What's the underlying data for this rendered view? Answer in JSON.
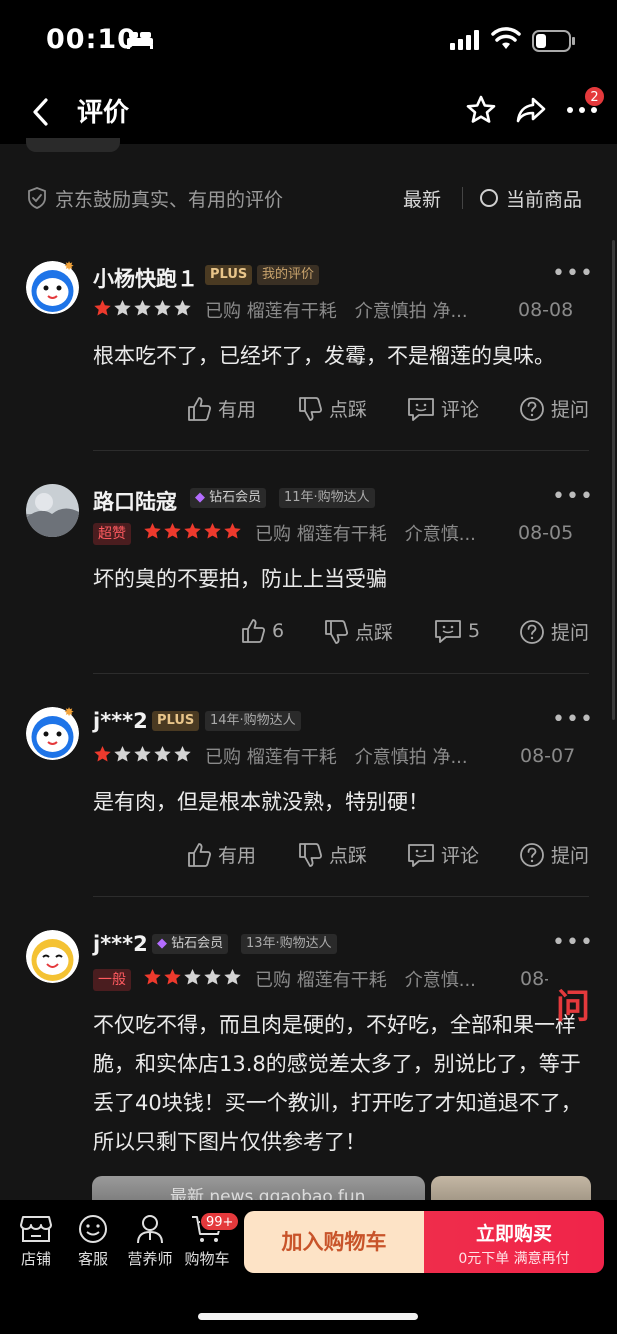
{
  "status_bar": {
    "time": "00:10"
  },
  "nav": {
    "title": "评价",
    "more_badge": "2"
  },
  "filter": {
    "encourage_text": "京东鼓励真实、有用的评价",
    "sort_latest": "最新",
    "current_product": "当前商品"
  },
  "reviews": [
    {
      "name": "小杨快跑１",
      "tags": [
        "PLUS",
        "我的评价"
      ],
      "rating": 1,
      "badge": "",
      "purchase": "已购 榴莲有干耗　介意慎拍 净...",
      "date": "08-08",
      "content": "根本吃不了，已经坏了，发霉，不是榴莲的臭味。",
      "useful": "有用",
      "dislike": "点踩",
      "comment": "评论",
      "ask": "提问"
    },
    {
      "name": "路口陆寇",
      "tags": [
        "钻石会员",
        "11年·购物达人"
      ],
      "rating": 5,
      "badge": "超赞",
      "purchase": "已购 榴莲有干耗　介意慎...",
      "date": "08-05",
      "content": "坏的臭的不要拍，防止上当受骗",
      "useful": "6",
      "dislike": "点踩",
      "comment": "5",
      "ask": "提问"
    },
    {
      "name": "j***2",
      "tags": [
        "PLUS",
        "14年·购物达人"
      ],
      "rating": 1,
      "badge": "",
      "purchase": "已购 榴莲有干耗　介意慎拍 净...",
      "date": "08-07",
      "content": "是有肉，但是根本就没熟，特别硬！",
      "useful": "有用",
      "dislike": "点踩",
      "comment": "评论",
      "ask": "提问"
    },
    {
      "name": "j***2",
      "tags": [
        "钻石会员",
        "13年·购物达人"
      ],
      "rating": 2,
      "badge": "一般",
      "purchase": "已购 榴莲有干耗　介意慎...",
      "date": "08-07",
      "content": "不仅吃不得，而且肉是硬的，不好吃，全部和果一样脆，和实体店13.8的感觉差太多了，别说比了，等于丢了40块钱！买一个教训，打开吃了才知道退不了，所以只剩下图片仅供参考了！",
      "watermark": "最新 news.qqaobao.fun"
    }
  ],
  "float_ask": "问",
  "bottom": {
    "store": "店铺",
    "service": "客服",
    "nutritionist": "营养师",
    "cart": "购物车",
    "cart_badge": "99+",
    "add_to_cart": "加入购物车",
    "buy_now": "立即购买",
    "buy_now_sub": "0元下单 满意再付"
  },
  "colors": {
    "accent": "#e4393c",
    "star": "#ee3a2d",
    "background": "#151515"
  }
}
